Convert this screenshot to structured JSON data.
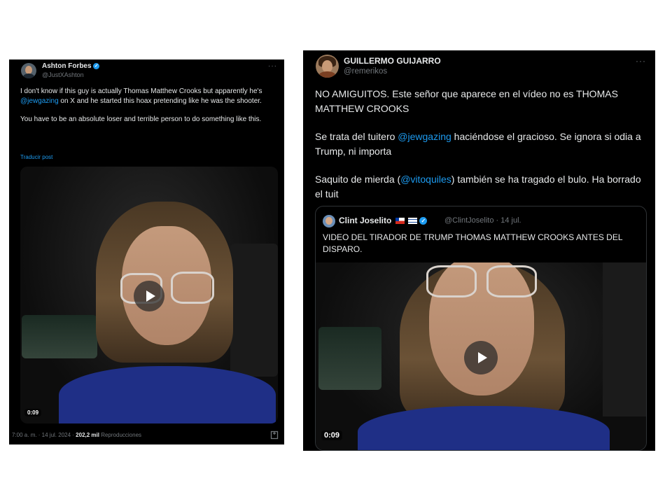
{
  "left_tweet": {
    "author_name": "Ashton Forbes",
    "author_handle": "@JustXAshton",
    "more_label": "···",
    "text_1_before": "I don't know if this guy is actually Thomas Matthew Crooks but apparently he's ",
    "mention_1": "@jewgazing",
    "text_1_after": " on X and he started this hoax pretending like he was the shooter.",
    "text_2": "You have to be an absolute loser and terrible person to do something like this.",
    "translate_label": "Traducir post",
    "video_duration": "0:09",
    "meta_time": "7:00 a. m. · 14 jul. 2024 · ",
    "meta_views": "202,2 mil",
    "meta_views_label": " Reproducciones"
  },
  "right_tweet": {
    "author_name": "GUILLERMO GUIJARRO",
    "author_handle": "@remerikos",
    "more_label": "···",
    "para_1": "NO AMIGUITOS. Este señor que aparece en el vídeo no es THOMAS MATTHEW CROOKS",
    "para_2_before": "Se trata del tuitero ",
    "para_2_mention": "@jewgazing",
    "para_2_after": " haciéndose el gracioso. Se ignora si odia a Trump, ni importa",
    "para_3_before": "Saquito de mierda (",
    "para_3_mention": "@vitoquiles",
    "para_3_after": ") también se ha tragado el bulo. Ha borrado el tuit",
    "quote": {
      "author_name": "Clint Joselito",
      "author_handle": "@ClintJoselito",
      "date": " · 14 jul.",
      "text": "VIDEO DEL TIRADOR DE TRUMP THOMAS MATTHEW CROOKS ANTES DEL DISPARO.",
      "video_duration": "0:09"
    }
  },
  "colors": {
    "background": "#000000",
    "text": "#e7e9ea",
    "muted": "#71767b",
    "link": "#1d9bf0",
    "shirt": "#1f2f86"
  },
  "icons": {
    "verified": "verified-badge-icon",
    "play": "play-icon",
    "more": "more-options-icon",
    "bookmark": "bookmark-icon"
  }
}
